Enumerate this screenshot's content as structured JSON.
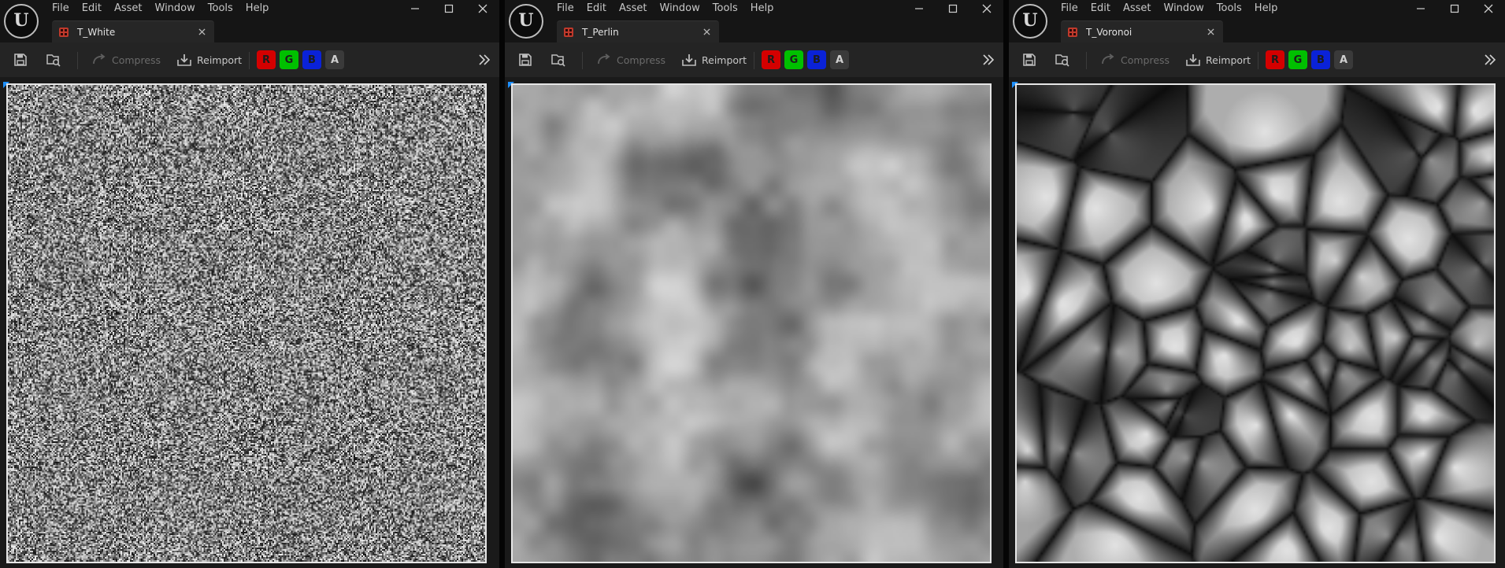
{
  "app": {
    "logo_letter": "U",
    "menu": [
      "File",
      "Edit",
      "Asset",
      "Window",
      "Tools",
      "Help"
    ]
  },
  "toolbar": {
    "compress_label": "Compress",
    "reimport_label": "Reimport",
    "channels": [
      "R",
      "G",
      "B",
      "A"
    ]
  },
  "editors": [
    {
      "tab_title": "T_White",
      "texture_kind": "white-noise"
    },
    {
      "tab_title": "T_Perlin",
      "texture_kind": "perlin-noise"
    },
    {
      "tab_title": "T_Voronoi",
      "texture_kind": "voronoi-noise"
    }
  ],
  "colors": {
    "channel_r": "#d40000",
    "channel_g": "#00c000",
    "channel_b": "#0a22d8",
    "tab_icon": "#c0392b",
    "viewport_corner": "#1e90ff"
  },
  "icons": {
    "save": "save-icon",
    "browse": "browse-icon",
    "compress": "compress-icon",
    "reimport": "reimport-icon",
    "more": "chevron-double-right-icon",
    "close": "close-icon"
  }
}
